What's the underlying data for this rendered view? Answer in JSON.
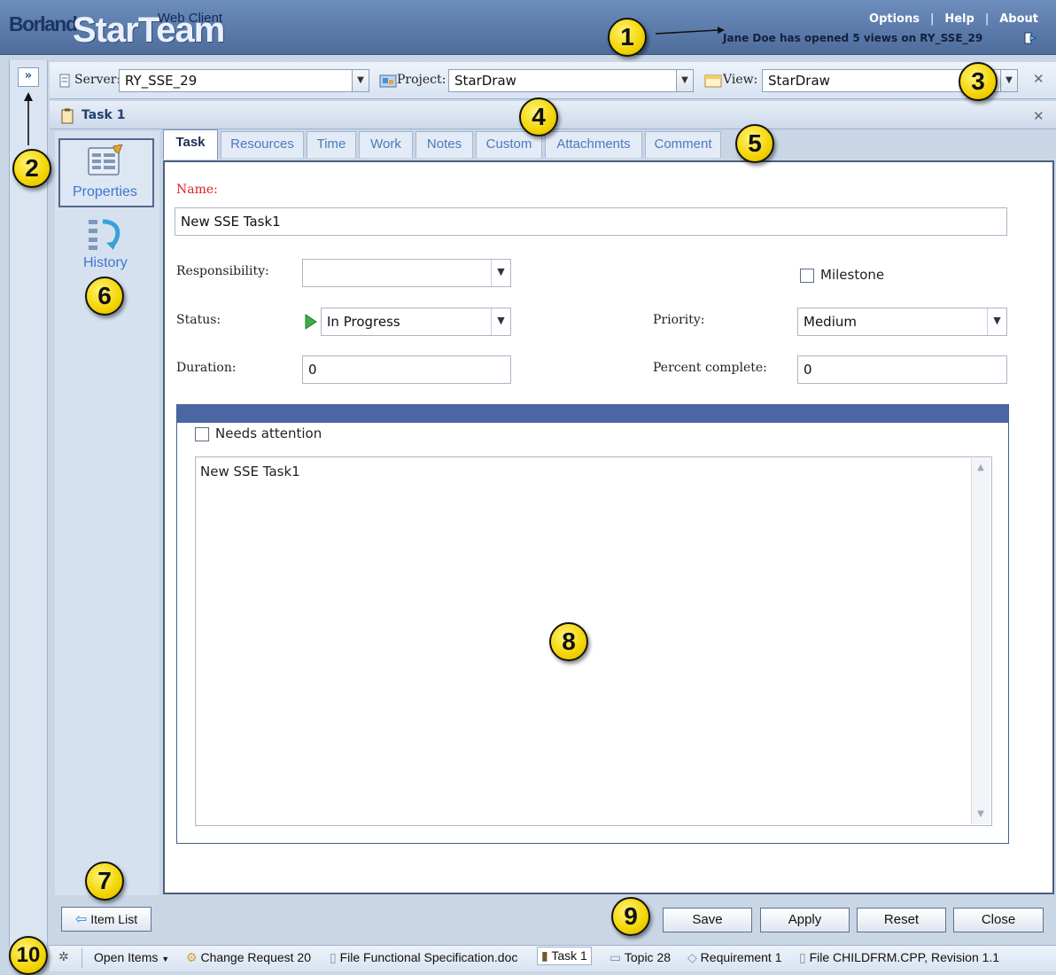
{
  "app": {
    "brand": "Borland",
    "product": "StarTeam",
    "edition": "Web Client"
  },
  "top_links": {
    "options": "Options",
    "help": "Help",
    "about": "About",
    "separator": "|"
  },
  "status_message": "Jane Doe has opened 5 views on RY_SSE_29",
  "server_bar": {
    "server_label": "Server:",
    "server_value": "RY_SSE_29",
    "project_label": "Project:",
    "project_value": "StarDraw",
    "view_label": "View:",
    "view_value": "StarDraw"
  },
  "task_header": {
    "title": "Task 1"
  },
  "side_nav": {
    "properties": "Properties",
    "history": "History"
  },
  "tabs": [
    "Task",
    "Resources",
    "Time",
    "Work",
    "Notes",
    "Custom",
    "Attachments",
    "Comment"
  ],
  "form": {
    "name_label": "Name:",
    "name_value": "New SSE Task1",
    "responsibility_label": "Responsibility:",
    "responsibility_value": "",
    "milestone_label": "Milestone",
    "status_label": "Status:",
    "status_value": "In Progress",
    "priority_label": "Priority:",
    "priority_value": "Medium",
    "duration_label": "Duration:",
    "duration_value": "0",
    "percent_label": "Percent complete:",
    "percent_value": "0",
    "needs_attention_label": "Needs attention",
    "memo_text": "New SSE Task1"
  },
  "buttons": {
    "item_list": "Item List",
    "save": "Save",
    "apply": "Apply",
    "reset": "Reset",
    "close": "Close"
  },
  "bottom_bar": {
    "open_items": "Open Items",
    "items": [
      "Change Request 20",
      "File Functional Specification.doc",
      "Task 1",
      "Topic 28",
      "Requirement 1",
      "File CHILDFRM.CPP, Revision 1.1"
    ]
  },
  "callouts": [
    "1",
    "2",
    "3",
    "4",
    "5",
    "6",
    "7",
    "8",
    "9",
    "10"
  ],
  "colors": {
    "banner": "#5a79a9",
    "accent_blue": "#3c78cd",
    "required_red": "#e32020",
    "callout_yellow": "#f3d400"
  }
}
